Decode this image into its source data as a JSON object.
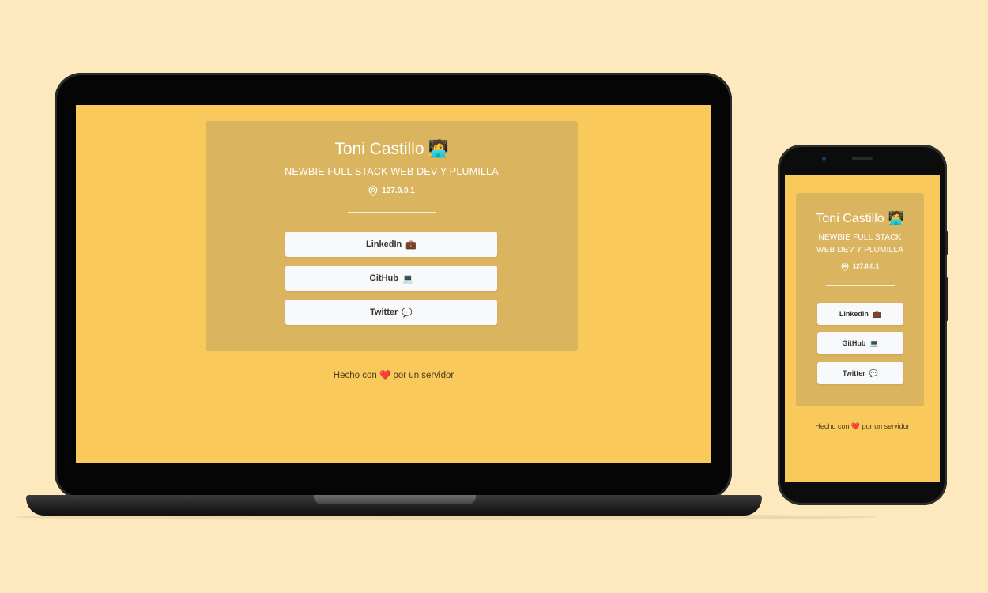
{
  "profile": {
    "name": "Toni Castillo",
    "name_emoji": "🧑‍💻",
    "subtitle": "NEWBIE FULL STACK WEB DEV Y PLUMILLA",
    "location": "127.0.0.1"
  },
  "links": [
    {
      "label": "LinkedIn",
      "emoji": "💼"
    },
    {
      "label": "GitHub",
      "emoji": "💻"
    },
    {
      "label": "Twitter",
      "emoji": "💬"
    }
  ],
  "footer": {
    "before": "Hecho con",
    "heart": "❤️",
    "after": "por un servidor"
  },
  "colors": {
    "background": "#fde9bd",
    "page": "#f9c95b",
    "card": "#dbb460",
    "button": "#f8f9fb"
  }
}
